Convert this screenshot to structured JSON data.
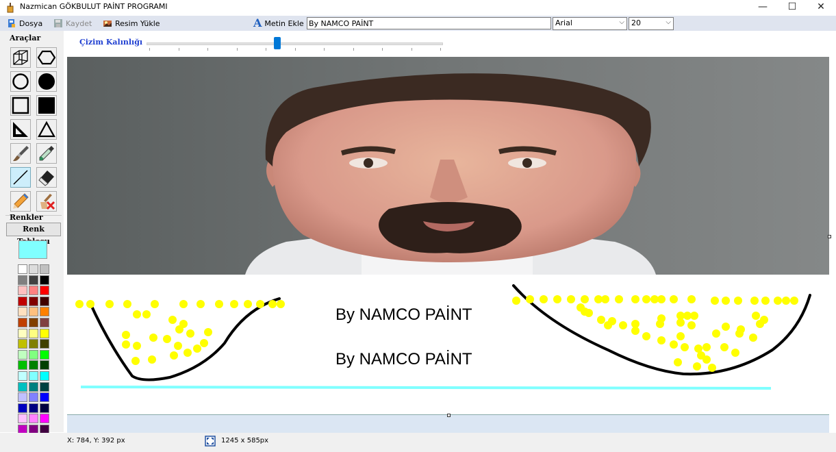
{
  "window": {
    "title": "Nazmican GÖKBULUT PAİNT PROGRAMI",
    "minimize": "—",
    "maximize": "☐",
    "close": "✕"
  },
  "toolbar": {
    "file": "Dosya",
    "save": "Kaydet",
    "load_image": "Resim Yükle",
    "add_text": "Metin Ekle",
    "text_value": "By NAMCO PAİNT",
    "font": "Arial",
    "font_size": "20"
  },
  "tools": {
    "section_label": "Araçlar",
    "items": [
      "cube-icon",
      "hexagon-icon",
      "circle-outline-icon",
      "circle-filled-icon",
      "square-outline-icon",
      "square-filled-icon",
      "right-triangle-icon",
      "triangle-icon",
      "brush-icon",
      "eyedropper-icon",
      "line-icon",
      "eraser-icon",
      "pencil-icon",
      "clear-icon"
    ],
    "active": "line-icon"
  },
  "colors": {
    "section_label": "Renkler",
    "table_button": "Renk Tablosu",
    "current": "#80ffff",
    "palette": [
      [
        "#ffffff",
        "#dcdcdc",
        "#c0c0c0"
      ],
      [
        "#808080",
        "#404040",
        "#000000"
      ],
      [
        "#ffc0c0",
        "#ff8080",
        "#ff0000"
      ],
      [
        "#c00000",
        "#800000",
        "#400000"
      ],
      [
        "#ffe0c0",
        "#ffc080",
        "#ff8000"
      ],
      [
        "#c04000",
        "#804000",
        "#804040"
      ],
      [
        "#ffffc0",
        "#ffff80",
        "#ffff00"
      ],
      [
        "#c0c000",
        "#808000",
        "#404000"
      ],
      [
        "#c0ffc0",
        "#80ff80",
        "#00ff00"
      ],
      [
        "#00c000",
        "#008000",
        "#004000"
      ],
      [
        "#c0ffff",
        "#80ffff",
        "#00ffff"
      ],
      [
        "#00c0c0",
        "#008080",
        "#004040"
      ],
      [
        "#c0c0ff",
        "#8080ff",
        "#0000ff"
      ],
      [
        "#0000c0",
        "#000080",
        "#000040"
      ],
      [
        "#ffc0ff",
        "#ff80ff",
        "#ff00ff"
      ],
      [
        "#c000c0",
        "#800080",
        "#400040"
      ]
    ]
  },
  "stroke": {
    "label": "Çizim Kalınlığı",
    "level": 0.44
  },
  "canvas": {
    "text_lines": [
      "By NAMCO PAİNT",
      "By NAMCO PAİNT"
    ]
  },
  "status": {
    "coords": "X: 784, Y: 392 px",
    "size": "1245 x 585px"
  }
}
